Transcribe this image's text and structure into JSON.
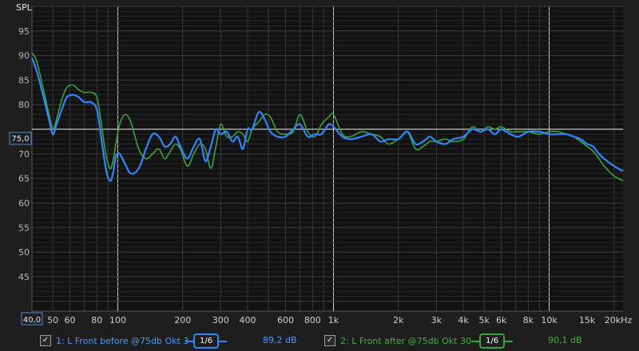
{
  "app": {
    "ylabel": "SPL",
    "cursor_level": "75,0",
    "x_start_label": "40,0"
  },
  "legend": [
    {
      "checked": true,
      "label": "1: L Front before @75db Okt 3",
      "smoothing": "1/6",
      "level": "89,2 dB",
      "color": "#2f86ff"
    },
    {
      "checked": true,
      "label": "2: L Front after @75db Okt 30",
      "smoothing": "1/6",
      "level": "90,1 dB",
      "color": "#3aa33a"
    }
  ],
  "chart_data": {
    "type": "line",
    "xscale": "log",
    "xlim": [
      40,
      22000
    ],
    "ylim": [
      38,
      100
    ],
    "ylabel": "SPL",
    "grid": true,
    "reference_line": 75,
    "x_tick_labels": [
      {
        "v": 50,
        "t": "50"
      },
      {
        "v": 60,
        "t": "60"
      },
      {
        "v": 80,
        "t": "80"
      },
      {
        "v": 100,
        "t": "100"
      },
      {
        "v": 200,
        "t": "200"
      },
      {
        "v": 300,
        "t": "300"
      },
      {
        "v": 400,
        "t": "400"
      },
      {
        "v": 600,
        "t": "600"
      },
      {
        "v": 800,
        "t": "800"
      },
      {
        "v": 1000,
        "t": "1k"
      },
      {
        "v": 2000,
        "t": "2k"
      },
      {
        "v": 3000,
        "t": "3k"
      },
      {
        "v": 4000,
        "t": "4k"
      },
      {
        "v": 5000,
        "t": "5k"
      },
      {
        "v": 6000,
        "t": "6k"
      },
      {
        "v": 8000,
        "t": "8k"
      },
      {
        "v": 10000,
        "t": "10k"
      },
      {
        "v": 15000,
        "t": "15k"
      },
      {
        "v": 20000,
        "t": "20kHz"
      }
    ],
    "y_tick_labels": [
      "45",
      "50",
      "55",
      "60",
      "65",
      "70",
      "80",
      "85",
      "90",
      "95"
    ],
    "y_ticks": [
      45,
      50,
      55,
      60,
      65,
      70,
      80,
      85,
      90,
      95
    ],
    "series": [
      {
        "name": "1: L Front before @75db Okt 3",
        "color": "#2f86ff",
        "x": [
          40,
          42,
          45,
          48,
          50,
          52,
          55,
          58,
          62,
          66,
          70,
          75,
          80,
          84,
          88,
          92,
          95,
          98,
          102,
          108,
          115,
          125,
          135,
          145,
          155,
          165,
          175,
          185,
          195,
          210,
          225,
          240,
          255,
          270,
          285,
          300,
          320,
          340,
          360,
          380,
          400,
          420,
          450,
          480,
          510,
          550,
          600,
          650,
          700,
          760,
          820,
          880,
          950,
          1000,
          1100,
          1200,
          1350,
          1500,
          1650,
          1800,
          2000,
          2200,
          2400,
          2600,
          2800,
          3000,
          3300,
          3600,
          4000,
          4400,
          4800,
          5200,
          5600,
          6000,
          6600,
          7200,
          8000,
          9000,
          10000,
          11000,
          12000,
          13000,
          14000,
          15000,
          16000,
          17000,
          18000,
          20000,
          22000
        ],
        "y": [
          89.5,
          87,
          82,
          77,
          74,
          76,
          79,
          81.5,
          82,
          81.5,
          80.5,
          80.5,
          79,
          73,
          67,
          64.5,
          66,
          69.5,
          70,
          68,
          66,
          67,
          71,
          74,
          73.5,
          71.5,
          72,
          73.5,
          71.5,
          69,
          71.5,
          73,
          68.5,
          71.5,
          75,
          74,
          74.5,
          72.5,
          73.5,
          71,
          75,
          75,
          78.5,
          77,
          74.5,
          73.5,
          73.5,
          75,
          76,
          73.5,
          74,
          74,
          76,
          75.5,
          73.5,
          73,
          73.5,
          74,
          72.5,
          73,
          73,
          74.5,
          72,
          72.5,
          73.5,
          72.5,
          72,
          73,
          73.5,
          75,
          74.5,
          75,
          74,
          75,
          74,
          73.5,
          74.5,
          74.5,
          74,
          74,
          74,
          73.5,
          73,
          72,
          71.5,
          70,
          69,
          67.5,
          66.5
        ]
      },
      {
        "name": "2: L Front after @75db Okt 30",
        "color": "#3aa33a",
        "x": [
          40,
          42,
          45,
          48,
          50,
          52,
          55,
          58,
          62,
          66,
          70,
          75,
          80,
          84,
          88,
          92,
          95,
          98,
          102,
          108,
          115,
          125,
          135,
          145,
          155,
          165,
          175,
          185,
          195,
          210,
          225,
          240,
          255,
          270,
          285,
          300,
          320,
          340,
          360,
          380,
          400,
          420,
          450,
          480,
          510,
          550,
          600,
          650,
          700,
          760,
          820,
          880,
          950,
          1000,
          1100,
          1200,
          1350,
          1500,
          1650,
          1800,
          2000,
          2200,
          2400,
          2600,
          2800,
          3000,
          3300,
          3600,
          4000,
          4400,
          4800,
          5200,
          5600,
          6000,
          6600,
          7200,
          8000,
          9000,
          10000,
          11000,
          12000,
          13000,
          14000,
          15000,
          16000,
          17000,
          18000,
          20000,
          22000
        ],
        "y": [
          90.5,
          89,
          83.5,
          78,
          75,
          77,
          81,
          83.5,
          84,
          83,
          82.5,
          82.5,
          81.5,
          76,
          70,
          67,
          68.5,
          72,
          76,
          78,
          76.5,
          71,
          69,
          70,
          71,
          69,
          70.5,
          72,
          71,
          67.5,
          70,
          72,
          71,
          67,
          71.5,
          76,
          73.5,
          73.5,
          74.5,
          74,
          72.5,
          75,
          76.5,
          78,
          77.5,
          74.5,
          74,
          74.5,
          78,
          74.5,
          73.5,
          76,
          77.5,
          78,
          74,
          73.5,
          74.5,
          74,
          73.5,
          72,
          73,
          74.5,
          71,
          71.5,
          72.5,
          72.5,
          73,
          72.5,
          73,
          75.5,
          74.5,
          75.5,
          75,
          75.5,
          74.5,
          74.5,
          74.5,
          74,
          74.5,
          74.5,
          74,
          73.5,
          72.5,
          71.5,
          70.5,
          69,
          67.5,
          65.5,
          64.5
        ]
      }
    ]
  }
}
